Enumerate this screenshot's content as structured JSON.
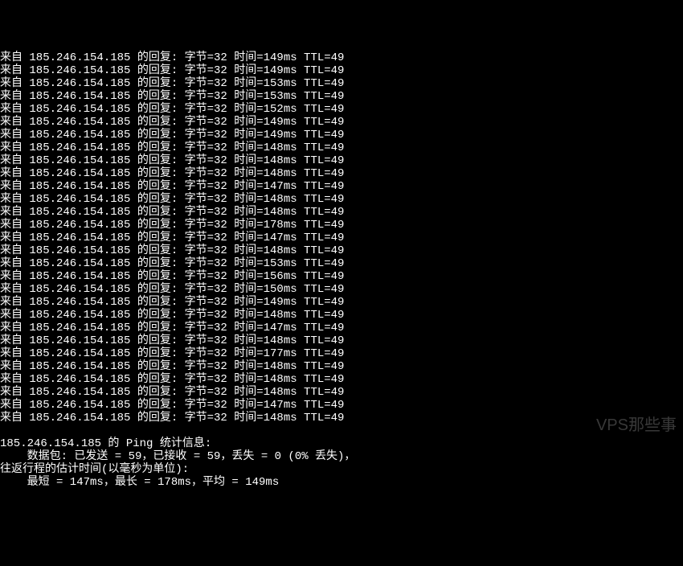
{
  "ip": "185.246.154.185",
  "reply_lines": [
    {
      "time": "149"
    },
    {
      "time": "149"
    },
    {
      "time": "153"
    },
    {
      "time": "153"
    },
    {
      "time": "152"
    },
    {
      "time": "149"
    },
    {
      "time": "149"
    },
    {
      "time": "148"
    },
    {
      "time": "148"
    },
    {
      "time": "148"
    },
    {
      "time": "147"
    },
    {
      "time": "148"
    },
    {
      "time": "148"
    },
    {
      "time": "178"
    },
    {
      "time": "147"
    },
    {
      "time": "148"
    },
    {
      "time": "153"
    },
    {
      "time": "156"
    },
    {
      "time": "150"
    },
    {
      "time": "149"
    },
    {
      "time": "148"
    },
    {
      "time": "147"
    },
    {
      "time": "148"
    },
    {
      "time": "177"
    },
    {
      "time": "148"
    },
    {
      "time": "148"
    },
    {
      "time": "148"
    },
    {
      "time": "147"
    },
    {
      "time": "148"
    }
  ],
  "bytes": "32",
  "ttl": "49",
  "labels": {
    "reply_prefix": "来自",
    "reply_suffix": "的回复:",
    "bytes_label": "字节",
    "time_label": "时间",
    "ttl_label": "TTL"
  },
  "stats": {
    "header_prefix": "",
    "header_middle": "的 Ping 统计信息:",
    "packets_line": "    数据包: 已发送 = 59，已接收 = 59，丢失 = 0 (0% 丢失)，",
    "rtt_header": "往返行程的估计时间(以毫秒为单位):",
    "rtt_values": "    最短 = 147ms，最长 = 178ms，平均 = 149ms"
  },
  "watermark": "VPS那些事"
}
